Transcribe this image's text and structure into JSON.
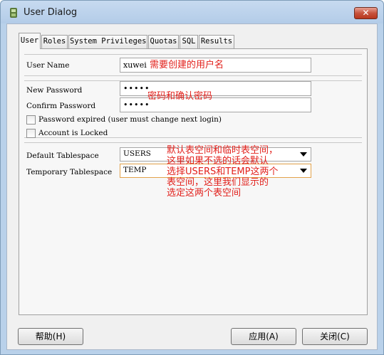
{
  "window": {
    "title": "User Dialog",
    "close_glyph": "✕"
  },
  "tabs": [
    {
      "label": "User"
    },
    {
      "label": "Roles"
    },
    {
      "label": "System Privileges"
    },
    {
      "label": "Quotas"
    },
    {
      "label": "SQL"
    },
    {
      "label": "Results"
    }
  ],
  "user": {
    "username_label": "User Name",
    "username_value": "xuwei",
    "username_note": "需要创建的用户名"
  },
  "password": {
    "password_label": "New Password",
    "password_value": "•••••",
    "confirm_label": "Confirm Password",
    "confirm_value": "•••••",
    "note": "密码和确认密码",
    "expired_label": "Password expired (user must change next login)",
    "locked_label": "Account is Locked"
  },
  "tablespace": {
    "default_label": "Default Tablespace",
    "default_value": "USERS",
    "temporary_label": "Temporary Tablespace",
    "temporary_value": "TEMP",
    "note_lines": [
      "默认表空间和临时表空间，",
      "这里如果不选的话会默认",
      "选择USERS和TEMP这两个",
      "表空间，这里我们显示的",
      "选定这两个表空间"
    ]
  },
  "buttons": {
    "help": "帮助(H)",
    "apply": "应用(A)",
    "close": "关闭(C)"
  }
}
